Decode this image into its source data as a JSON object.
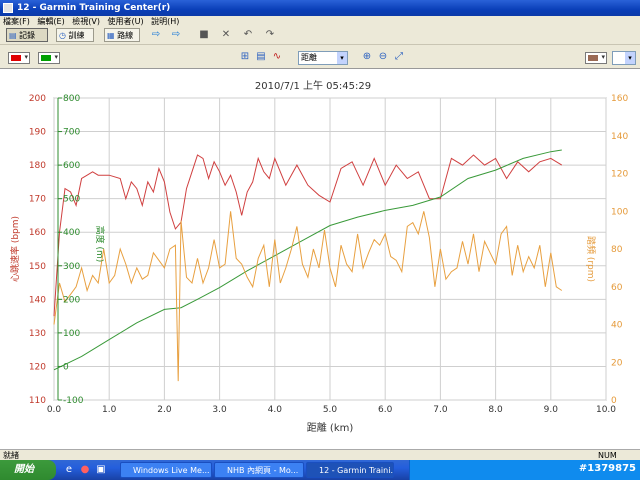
{
  "window": {
    "title": "12 - Garmin Training Center(r)",
    "menu": [
      "檔案(F)",
      "編輯(E)",
      "檢視(V)",
      "使用者(U)",
      "說明(H)"
    ]
  },
  "toolbar": {
    "tabs": [
      "記錄",
      "訓練",
      "路線"
    ]
  },
  "view_toolbar": {
    "primary_color": "#e00000",
    "secondary_color": "#00a000",
    "xaxis_selector": "距離",
    "right_color": "#9b6b55"
  },
  "status": {
    "left": "就緒",
    "right": "NUM"
  },
  "taskbar": {
    "start": "開始",
    "items": [
      "Windows Live Me...",
      "NHB 內網頁 - Mo...",
      "12 - Garmin Traini..."
    ],
    "watermark": "#1379875"
  },
  "chart_data": {
    "type": "line",
    "title": "2010/7/1 上午 05:45:29",
    "xlabel": "距離 (km)",
    "x_ticks": [
      "0.0",
      "1.0",
      "2.0",
      "3.0",
      "4.0",
      "5.0",
      "6.0",
      "7.0",
      "8.0",
      "9.0",
      "10.0"
    ],
    "xlim": [
      0,
      10
    ],
    "grid": true,
    "axes": {
      "hr": {
        "label": "心跳速率 (bpm)",
        "color": "#c0392b",
        "range": [
          110,
          200
        ],
        "ticks": [
          "110",
          "120",
          "130",
          "140",
          "150",
          "160",
          "170",
          "180",
          "190",
          "200"
        ]
      },
      "elev": {
        "label": "高度 (m)",
        "color": "#2e8b2e",
        "range": [
          -100,
          800
        ],
        "ticks": [
          "-100",
          "0",
          "100",
          "200",
          "300",
          "400",
          "500",
          "600",
          "700",
          "800"
        ]
      },
      "cad": {
        "label": "踏頻 (rpm)",
        "color": "#e59a3a",
        "range": [
          0,
          160
        ],
        "ticks": [
          "0",
          "20",
          "40",
          "60",
          "80",
          "100",
          "120",
          "140",
          "160"
        ]
      }
    },
    "series": [
      {
        "name": "心跳速率",
        "axis": "hr",
        "color": "#d04040",
        "x": [
          0.0,
          0.1,
          0.2,
          0.3,
          0.4,
          0.5,
          0.6,
          0.7,
          0.8,
          1.0,
          1.2,
          1.3,
          1.4,
          1.5,
          1.6,
          1.7,
          1.8,
          1.9,
          2.0,
          2.1,
          2.2,
          2.3,
          2.4,
          2.5,
          2.6,
          2.7,
          2.8,
          2.9,
          3.0,
          3.1,
          3.2,
          3.3,
          3.4,
          3.5,
          3.6,
          3.7,
          3.8,
          3.9,
          4.0,
          4.2,
          4.4,
          4.6,
          4.8,
          5.0,
          5.2,
          5.4,
          5.6,
          5.8,
          6.0,
          6.2,
          6.4,
          6.6,
          6.8,
          7.0,
          7.2,
          7.4,
          7.6,
          7.8,
          8.0,
          8.2,
          8.4,
          8.6,
          8.8,
          9.0,
          9.2
        ],
        "y": [
          135,
          160,
          173,
          172,
          168,
          176,
          177,
          178,
          177,
          177,
          176,
          170,
          175,
          173,
          168,
          175,
          172,
          179,
          175,
          166,
          161,
          163,
          173,
          178,
          183,
          182,
          176,
          181,
          178,
          174,
          177,
          172,
          165,
          172,
          175,
          182,
          178,
          176,
          182,
          174,
          180,
          174,
          171,
          169,
          179,
          181,
          174,
          182,
          174,
          180,
          176,
          178,
          170,
          170,
          182,
          180,
          183,
          180,
          182,
          176,
          181,
          178,
          181,
          182,
          180
        ]
      },
      {
        "name": "高度",
        "axis": "elev",
        "color": "#3a9a3a",
        "x": [
          0.0,
          0.5,
          1.0,
          1.5,
          2.0,
          2.3,
          2.6,
          3.0,
          3.5,
          4.0,
          4.5,
          5.0,
          5.5,
          6.0,
          6.5,
          7.0,
          7.5,
          8.0,
          8.5,
          9.0,
          9.2
        ],
        "y": [
          -10,
          30,
          80,
          130,
          170,
          175,
          200,
          235,
          285,
          330,
          375,
          420,
          445,
          465,
          480,
          505,
          560,
          585,
          620,
          640,
          645
        ]
      },
      {
        "name": "踏頻",
        "axis": "cad",
        "color": "#e8a040",
        "x": [
          0.0,
          0.1,
          0.2,
          0.3,
          0.4,
          0.5,
          0.6,
          0.7,
          0.8,
          0.9,
          1.0,
          1.1,
          1.2,
          1.3,
          1.4,
          1.5,
          1.6,
          1.7,
          1.8,
          1.9,
          2.0,
          2.1,
          2.2,
          2.25,
          2.3,
          2.4,
          2.5,
          2.6,
          2.7,
          2.8,
          2.9,
          3.0,
          3.1,
          3.2,
          3.3,
          3.4,
          3.5,
          3.6,
          3.7,
          3.8,
          3.9,
          4.0,
          4.1,
          4.2,
          4.3,
          4.4,
          4.5,
          4.6,
          4.7,
          4.8,
          4.9,
          5.0,
          5.1,
          5.2,
          5.3,
          5.4,
          5.5,
          5.6,
          5.7,
          5.8,
          5.9,
          6.0,
          6.1,
          6.2,
          6.3,
          6.4,
          6.5,
          6.6,
          6.7,
          6.8,
          6.9,
          7.0,
          7.1,
          7.2,
          7.3,
          7.4,
          7.5,
          7.6,
          7.7,
          7.8,
          7.9,
          8.0,
          8.1,
          8.2,
          8.3,
          8.4,
          8.5,
          8.6,
          8.7,
          8.8,
          8.9,
          9.0,
          9.1,
          9.2
        ],
        "y": [
          40,
          62,
          52,
          56,
          60,
          70,
          58,
          66,
          62,
          80,
          62,
          66,
          80,
          72,
          62,
          70,
          64,
          66,
          78,
          74,
          70,
          80,
          82,
          10,
          95,
          65,
          62,
          75,
          62,
          70,
          85,
          70,
          72,
          100,
          75,
          72,
          65,
          60,
          75,
          82,
          60,
          85,
          62,
          70,
          80,
          92,
          72,
          65,
          80,
          70,
          90,
          70,
          60,
          82,
          72,
          68,
          88,
          70,
          78,
          85,
          82,
          88,
          76,
          74,
          68,
          92,
          94,
          88,
          100,
          86,
          60,
          80,
          64,
          68,
          70,
          84,
          72,
          88,
          68,
          84,
          78,
          72,
          88,
          92,
          66,
          82,
          68,
          76,
          70,
          82,
          60,
          78,
          60,
          58
        ]
      }
    ]
  }
}
